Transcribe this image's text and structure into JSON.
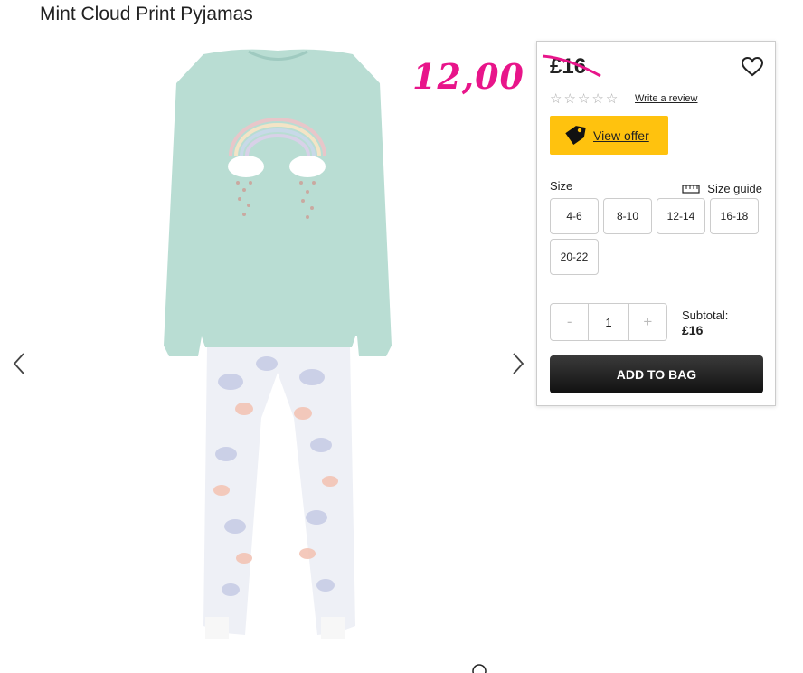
{
  "product": {
    "title": "Mint Cloud Print Pyjamas"
  },
  "promo": {
    "price_text": "12,00",
    "color": "#e8158a"
  },
  "panel": {
    "price": "£16",
    "review_link": "Write a review",
    "rating_stars": 0,
    "offer_label": "View offer",
    "size_label": "Size",
    "size_guide_label": "Size guide",
    "sizes": [
      "4-6",
      "8-10",
      "12-14",
      "16-18",
      "20-22"
    ],
    "quantity": {
      "minus": "-",
      "value": "1",
      "plus": "+"
    },
    "subtotal_label": "Subtotal:",
    "subtotal_value": "£16",
    "add_to_bag": "ADD TO BAG"
  },
  "colors": {
    "offer_yellow": "#ffc20e",
    "add_button": "#1a1a1a",
    "strike": "#e8158a"
  },
  "icons": [
    "chevron-left-icon",
    "chevron-right-icon",
    "heart-icon",
    "price-tag-icon",
    "ruler-icon",
    "star-outline-icon"
  ]
}
